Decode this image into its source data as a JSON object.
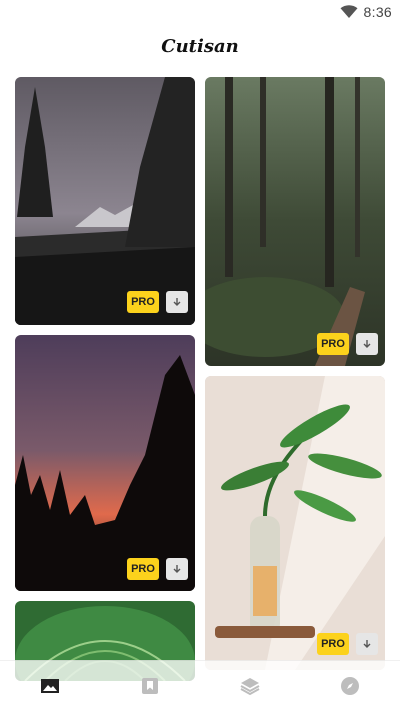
{
  "status_bar": {
    "time": "8:36"
  },
  "app": {
    "title": "Cutisan"
  },
  "cards": [
    {
      "id": "mountain-forest-dusk",
      "badge": "PRO"
    },
    {
      "id": "green-forest-trail",
      "badge": "PRO"
    },
    {
      "id": "sunset-silhouette-trees",
      "badge": "PRO"
    },
    {
      "id": "plant-in-bottle",
      "badge": "PRO"
    },
    {
      "id": "green-leaves"
    }
  ],
  "bottom_nav": {
    "items": [
      {
        "name": "wallpapers",
        "icon": "image-icon",
        "active": true
      },
      {
        "name": "bookmarks",
        "icon": "bookmark-icon",
        "active": false
      },
      {
        "name": "collections",
        "icon": "layers-icon",
        "active": false
      },
      {
        "name": "explore",
        "icon": "compass-icon",
        "active": false
      }
    ]
  },
  "colors": {
    "badge": "#fcd21c",
    "nav_active": "#222222",
    "nav_inactive": "#bdbdbd"
  }
}
